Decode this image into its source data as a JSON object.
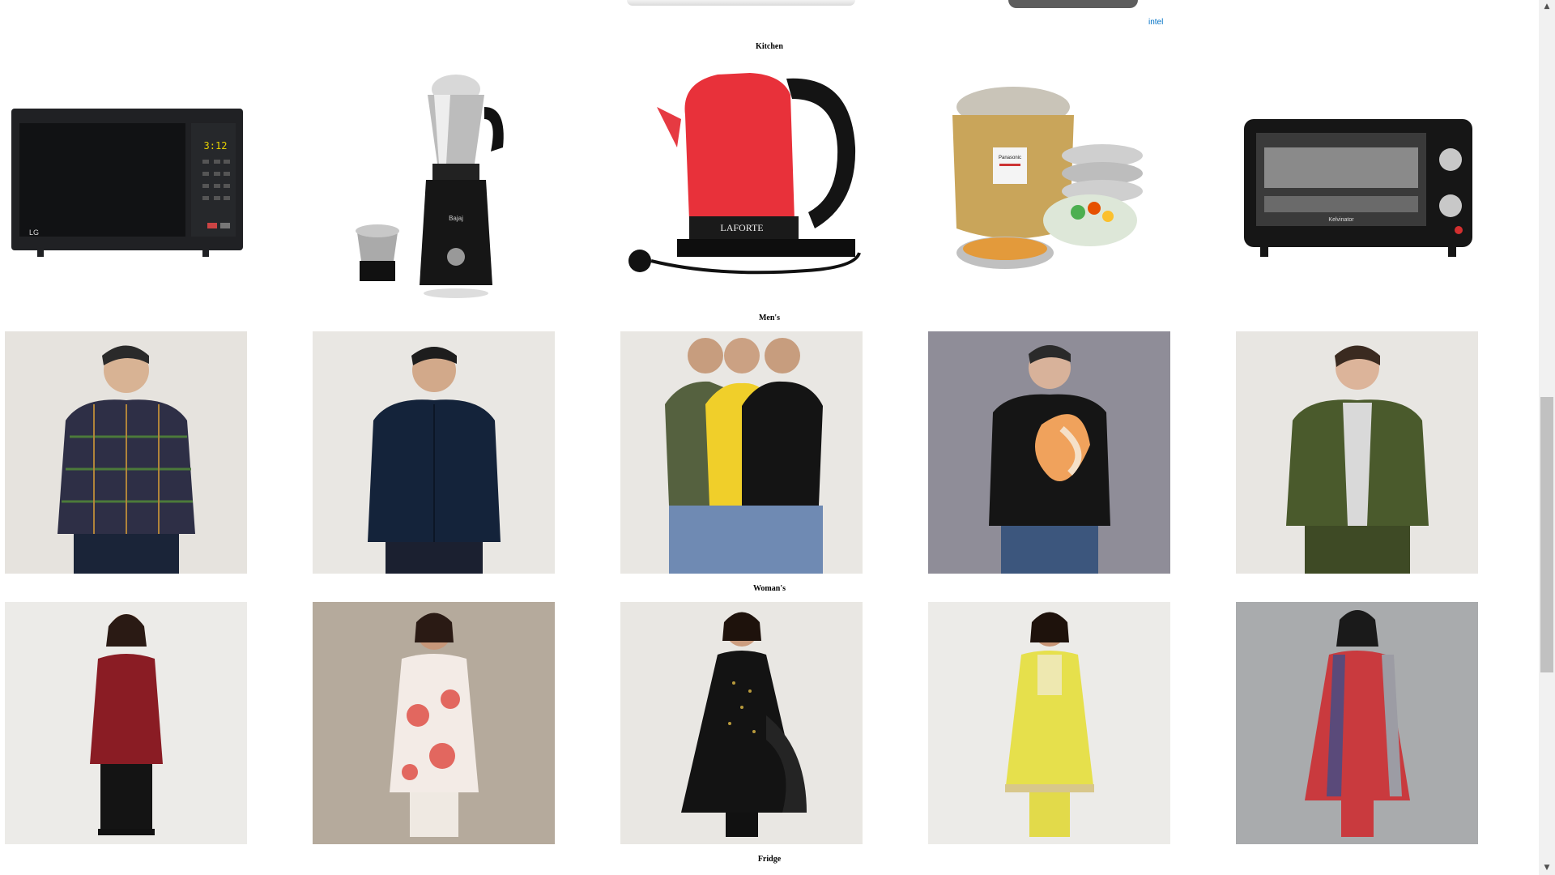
{
  "sections": {
    "kitchen": {
      "title": "Kitchen",
      "items": [
        {
          "name": "Microwave Oven",
          "brand_mark": "LG",
          "display": "3:12"
        },
        {
          "name": "Mixer Grinder",
          "brand_mark": "Bajaj"
        },
        {
          "name": "Electric Kettle",
          "brand_mark": "LA FORTE"
        },
        {
          "name": "Rice Cooker",
          "brand_mark": "Panasonic"
        },
        {
          "name": "OTG Oven",
          "brand_mark": "Kelvinator"
        }
      ]
    },
    "mens": {
      "title": "Men's",
      "items": [
        {
          "name": "Checked Shirt"
        },
        {
          "name": "Navy Shirt"
        },
        {
          "name": "Crew Neck T-Shirts Pack"
        },
        {
          "name": "Printed T-Shirt"
        },
        {
          "name": "Olive Denim Jacket"
        }
      ]
    },
    "womens": {
      "title": "Woman's",
      "items": [
        {
          "name": "Maroon Kurta Set"
        },
        {
          "name": "Floral Kurta Set"
        },
        {
          "name": "Black Anarkali Set"
        },
        {
          "name": "Yellow Kurta Set"
        },
        {
          "name": "Red Printed Kurta Set"
        }
      ]
    },
    "fridge": {
      "title": "Fridge"
    }
  },
  "top_partial": {
    "intel_label": "intel"
  },
  "colors": {
    "kettle": "#e8313a",
    "photo_bg": "#e9e7e3",
    "jacket": "#4a5a2c",
    "navy": "#14233a"
  },
  "icons": {
    "scroll_up": "scroll-up-arrow-icon",
    "scroll_down": "scroll-down-arrow-icon"
  }
}
